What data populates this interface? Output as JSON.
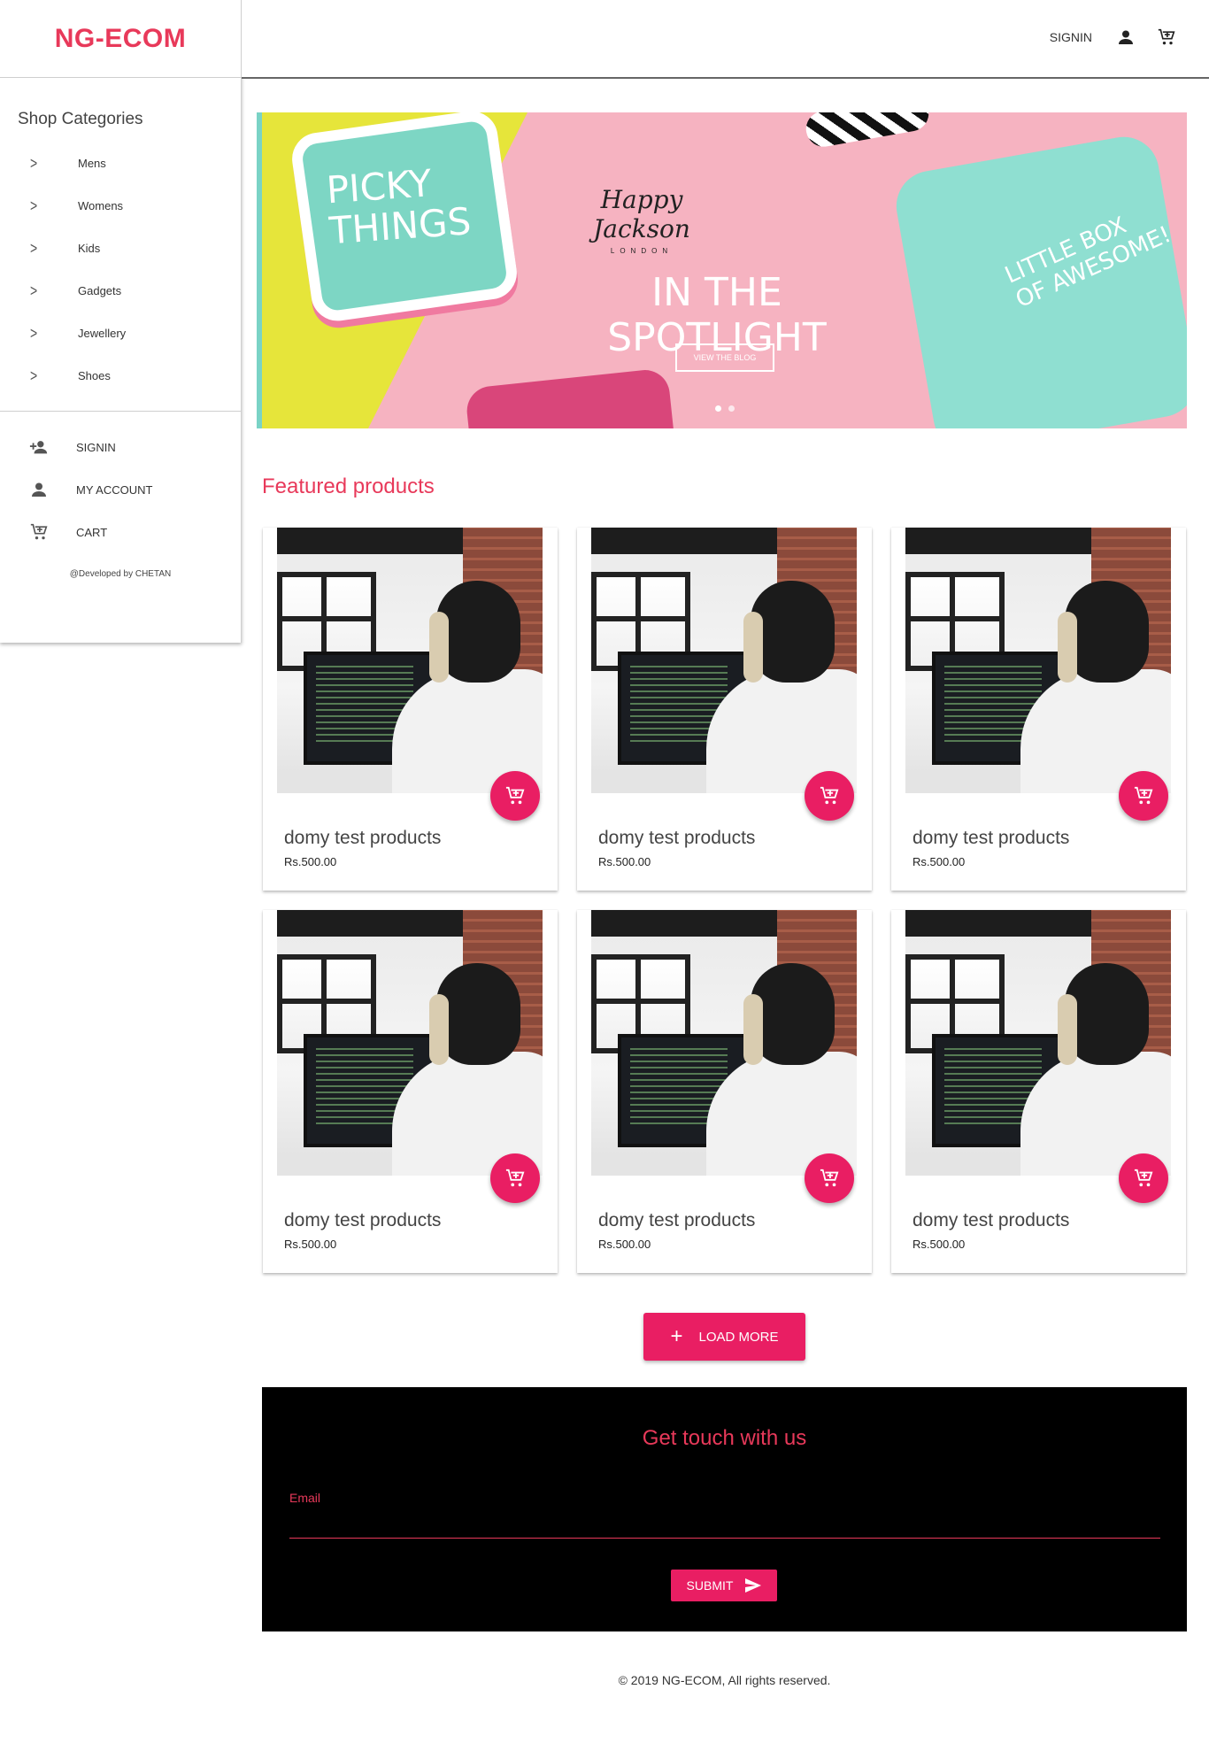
{
  "brand": "NG-ECOM",
  "sidebar": {
    "categories_title": "Shop Categories",
    "categories": [
      {
        "label": "Mens"
      },
      {
        "label": "Womens"
      },
      {
        "label": "Kids"
      },
      {
        "label": "Gadgets"
      },
      {
        "label": "Jewellery"
      },
      {
        "label": "Shoes"
      }
    ],
    "account_items": [
      {
        "label": "SIGNIN",
        "icon": "person-add-icon"
      },
      {
        "label": "MY ACCOUNT",
        "icon": "person-icon"
      },
      {
        "label": "CART",
        "icon": "cart-icon"
      }
    ],
    "developed_by": "@Developed by CHETAN"
  },
  "header": {
    "signin_label": "SIGNIN",
    "icons": [
      "person-icon",
      "cart-icon"
    ]
  },
  "banner": {
    "box_left_text": "PICKY THINGS",
    "logo_text": "Happy Jackson",
    "logo_subtext": "LONDON",
    "headline": "IN THE SPOTLIGHT",
    "box_right_text": "LITTLE BOX OF AWESOME!",
    "button_label": "VIEW THE BLOG",
    "slide_count": 2,
    "active_slide": 1
  },
  "featured": {
    "title": "Featured products",
    "products": [
      {
        "name": "domy test products",
        "price": "Rs.500.00"
      },
      {
        "name": "domy test products",
        "price": "Rs.500.00"
      },
      {
        "name": "domy test products",
        "price": "Rs.500.00"
      },
      {
        "name": "domy test products",
        "price": "Rs.500.00"
      },
      {
        "name": "domy test products",
        "price": "Rs.500.00"
      },
      {
        "name": "domy test products",
        "price": "Rs.500.00"
      }
    ],
    "load_more_label": "LOAD MORE"
  },
  "contact": {
    "title": "Get touch with us",
    "email_label": "Email",
    "email_value": "",
    "submit_label": "SUBMIT"
  },
  "footer": {
    "copyright": "© 2019 NG-ECOM, All rights reserved."
  },
  "colors": {
    "accent": "#e91e63",
    "brand": "#e8395a"
  }
}
